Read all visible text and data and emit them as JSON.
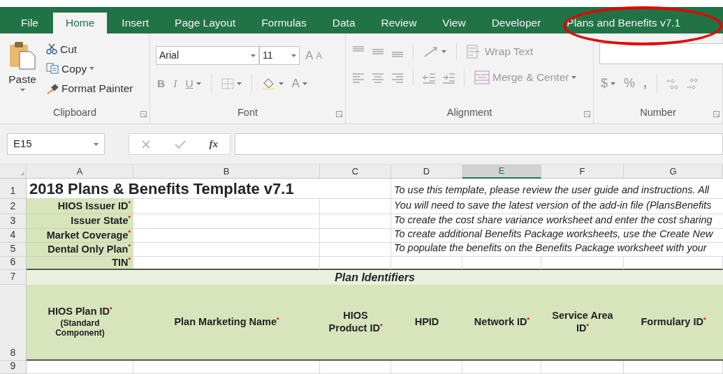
{
  "tabs": [
    {
      "label": "File",
      "selected": false,
      "circled": false
    },
    {
      "label": "Home",
      "selected": true,
      "circled": false
    },
    {
      "label": "Insert",
      "selected": false,
      "circled": false
    },
    {
      "label": "Page Layout",
      "selected": false,
      "circled": false
    },
    {
      "label": "Formulas",
      "selected": false,
      "circled": false
    },
    {
      "label": "Data",
      "selected": false,
      "circled": false
    },
    {
      "label": "Review",
      "selected": false,
      "circled": false
    },
    {
      "label": "View",
      "selected": false,
      "circled": false
    },
    {
      "label": "Developer",
      "selected": false,
      "circled": false
    },
    {
      "label": "Plans and Benefits v7.1",
      "selected": false,
      "circled": true
    }
  ],
  "clipboard": {
    "paste": "Paste",
    "cut": "Cut",
    "copy": "Copy",
    "format_painter": "Format Painter",
    "label": "Clipboard"
  },
  "font": {
    "font_name": "Arial",
    "font_size": "11",
    "grow": "A",
    "shrink": "A",
    "bold": "B",
    "italic": "I",
    "underline": "U",
    "font_color": "A",
    "label": "Font",
    "disabled": true
  },
  "alignment": {
    "wrap_text": "Wrap Text",
    "merge_center": "Merge & Center",
    "label": "Alignment",
    "disabled": true
  },
  "number": {
    "currency": "$",
    "percent": "%",
    "comma": ",",
    "label": "Number",
    "disabled": true
  },
  "formula_bar": {
    "name_box": "E15",
    "function_label": "fx"
  },
  "sheet": {
    "columns": [
      {
        "letter": "A",
        "selected": false
      },
      {
        "letter": "B",
        "selected": false
      },
      {
        "letter": "C",
        "selected": false
      },
      {
        "letter": "D",
        "selected": false
      },
      {
        "letter": "E",
        "selected": true
      },
      {
        "letter": "F",
        "selected": false
      },
      {
        "letter": "G",
        "selected": false
      }
    ],
    "row_numbers": [
      "1",
      "2",
      "3",
      "4",
      "5",
      "6",
      "7",
      "8",
      "9"
    ],
    "title": "2018 Plans & Benefits Template v7.1",
    "issuer_fields": [
      {
        "label": "HIOS Issuer ID",
        "required_mark": "*"
      },
      {
        "label": "Issuer State",
        "required_mark": "*"
      },
      {
        "label": "Market Coverage",
        "required_mark": "*"
      },
      {
        "label": "Dental Only Plan",
        "required_mark": "*"
      },
      {
        "label": "TIN",
        "required_mark": "*"
      }
    ],
    "instructions": [
      "To use this template, please review the user guide and instructions. All",
      "You will need to save the latest version of the add-in file (PlansBenefits",
      "To create the cost share variance worksheet and enter the cost sharing",
      "To create additional Benefits Package worksheets, use the Create New",
      "To populate the benefits on the Benefits Package worksheet with your"
    ],
    "section_title": "Plan Identifiers",
    "headers": [
      {
        "label": "HIOS Plan ID",
        "required_mark": "*",
        "note": "(Standard Component)"
      },
      {
        "label": "Plan Marketing Name",
        "required_mark": "*"
      },
      {
        "label": "HIOS Product ID",
        "required_mark": "*"
      },
      {
        "label": "HPID"
      },
      {
        "label": "Network ID",
        "required_mark": "*"
      },
      {
        "label": "Service Area ID",
        "required_mark": "*"
      },
      {
        "label": "Formulary ID",
        "required_mark": "*"
      }
    ]
  }
}
